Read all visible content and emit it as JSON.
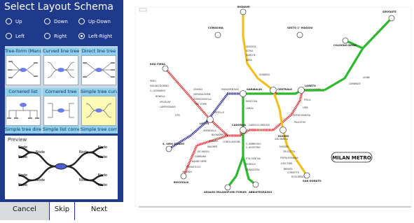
{
  "panel": {
    "title": "Select Layout Schema",
    "directions": [
      {
        "label": "Up",
        "selected": false
      },
      {
        "label": "Down",
        "selected": false
      },
      {
        "label": "Up-Down",
        "selected": false
      },
      {
        "label": "Left",
        "selected": false
      },
      {
        "label": "Right",
        "selected": false
      },
      {
        "label": "Left-Right",
        "selected": true
      }
    ],
    "layouts": [
      {
        "label": "Tree-form (Manual)"
      },
      {
        "label": "Curved line tree"
      },
      {
        "label": "Direct line tree"
      },
      {
        "label": "Cornered list"
      },
      {
        "label": "Cornered tree"
      },
      {
        "label": "Simple tree curved",
        "selected": true
      },
      {
        "label": "Simple tree direct"
      },
      {
        "label": "Simple list cornered"
      },
      {
        "label": "Simple tree cornered"
      }
    ],
    "preview": {
      "title": "Preview",
      "node_label": "Node"
    },
    "buttons": {
      "cancel": "Cancel",
      "skip": "Skip",
      "next": "Next"
    }
  },
  "map": {
    "title": "MILAN METRO",
    "colors": {
      "red": "#e03030",
      "green": "#2eb82e",
      "yellow": "#f0c020",
      "blue": "#2b2b8f"
    },
    "terminals": [
      "RHO FIERA",
      "BIGNAMI",
      "COMASINA",
      "SESTO 1° MAGGIO",
      "SEGGIATE",
      "COLOGNO NORD",
      "S. SIRO STADIO",
      "BISCEGLIA",
      "ASSAGO MILANOFIORI FORUM",
      "ABBIATEGRASSO",
      "SAN DONATO"
    ],
    "interchanges": [
      "GARIBALDI",
      "CENTRALE",
      "LORETO",
      "LOTTO",
      "CADORNA",
      "DUOMO"
    ],
    "stations": [
      "PERO",
      "MOLINO DORINO",
      "S. LEONARDO",
      "BONOLA",
      "URUGUAY",
      "LAMPUGNANO",
      "QT8",
      "AMENDOLA",
      "BUONARROTI",
      "PAGANO",
      "CONCILIAZIONE",
      "WAGNER",
      "DE ANGELI",
      "GAMBARA",
      "BANDE NERE",
      "PRIMATICCIO",
      "INGANNI",
      "PORTELLO",
      "TRE TORRI",
      "DOMODOSSOLA",
      "GERUSALEMME",
      "CENISIO",
      "MONUMENTALE",
      "SEGESTA",
      "ISTRIA",
      "MARCHE",
      "ZARA",
      "SONDRIO",
      "MOSCOVA",
      "LANZA",
      "CAIROLI",
      "CORDUSIO",
      "S. AMBROGIO",
      "S. AGOSTINO",
      "P.TA GENOVA",
      "ROMOLO",
      "FAMAGOSTA",
      "UDINE",
      "LAMBRATE",
      "PIOLA",
      "LIMA",
      "PORTA VENEZIA",
      "PALESTRO",
      "SAN BABILA",
      "MISSORI",
      "CROCETTA",
      "PORTA ROMANA",
      "LODI TIBB",
      "BRENTA",
      "CORVETTO",
      "ROGOREDO"
    ]
  }
}
